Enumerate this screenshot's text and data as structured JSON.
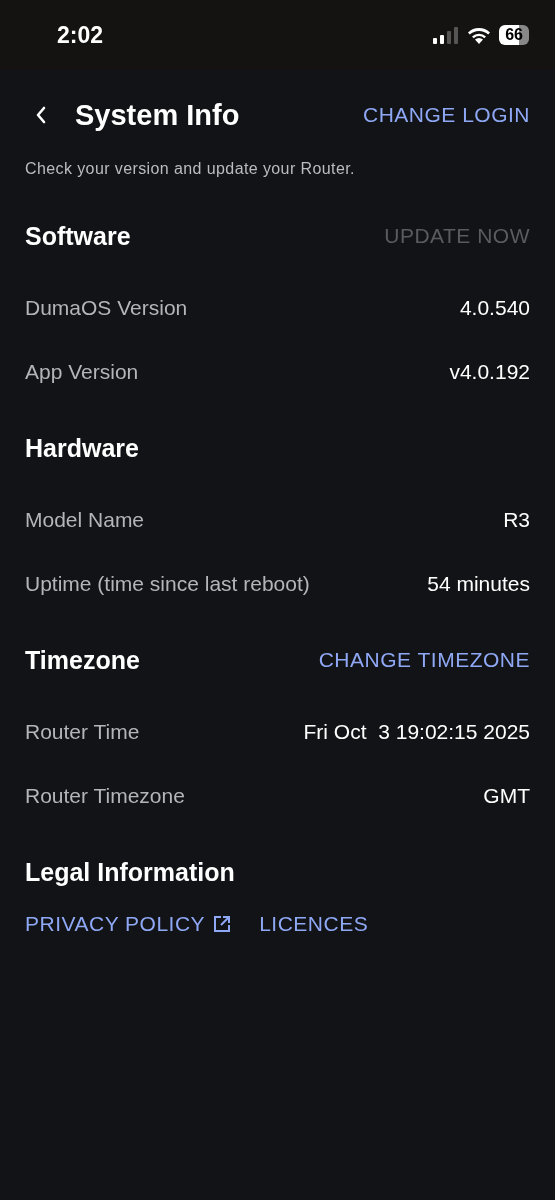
{
  "status_bar": {
    "time": "2:02",
    "battery": "66"
  },
  "header": {
    "title": "System Info",
    "action": "CHANGE LOGIN",
    "subtitle": "Check your version and update your Router."
  },
  "sections": [
    {
      "title": "Software",
      "action": {
        "label": "UPDATE NOW",
        "disabled": true
      },
      "rows": [
        {
          "label": "DumaOS Version",
          "value": "4.0.540"
        },
        {
          "label": "App Version",
          "value": "v4.0.192"
        }
      ]
    },
    {
      "title": "Hardware",
      "rows": [
        {
          "label": "Model Name",
          "value": "R3"
        },
        {
          "label": "Uptime (time since last reboot)",
          "value": "54 minutes"
        }
      ]
    },
    {
      "title": "Timezone",
      "action": {
        "label": "CHANGE TIMEZONE",
        "disabled": false
      },
      "rows": [
        {
          "label": "Router Time",
          "value": "Fri Oct  3 19:02:15 2025"
        },
        {
          "label": "Router Timezone",
          "value": "GMT"
        }
      ]
    },
    {
      "title": "Legal Information",
      "links": [
        {
          "label": "PRIVACY POLICY",
          "kind": "external"
        },
        {
          "label": "LICENCES",
          "kind": "plain"
        }
      ]
    }
  ]
}
